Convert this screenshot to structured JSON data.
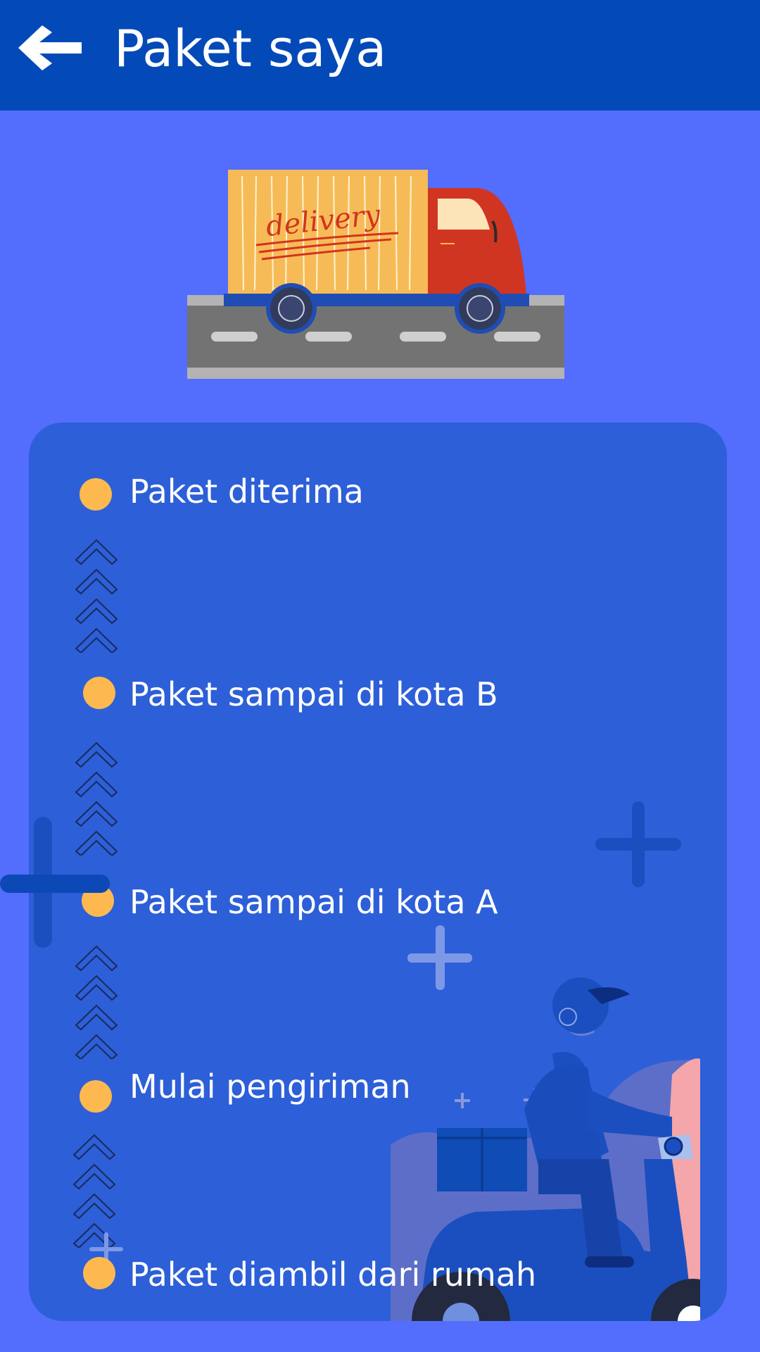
{
  "header": {
    "title": "Paket saya",
    "back_icon": "arrow-left-icon"
  },
  "illustration": {
    "truck_text": "delivery"
  },
  "timeline": {
    "steps": [
      {
        "label": "Paket diterima"
      },
      {
        "label": "Paket sampai di kota B"
      },
      {
        "label": "Paket sampai di kota A"
      },
      {
        "label": "Mulai pengiriman"
      },
      {
        "label": "Paket diambil dari rumah"
      }
    ]
  },
  "colors": {
    "header": "#034ab8",
    "background": "#536dfc",
    "card": "#2d5fd8",
    "status_dot": "#fdb94f"
  }
}
